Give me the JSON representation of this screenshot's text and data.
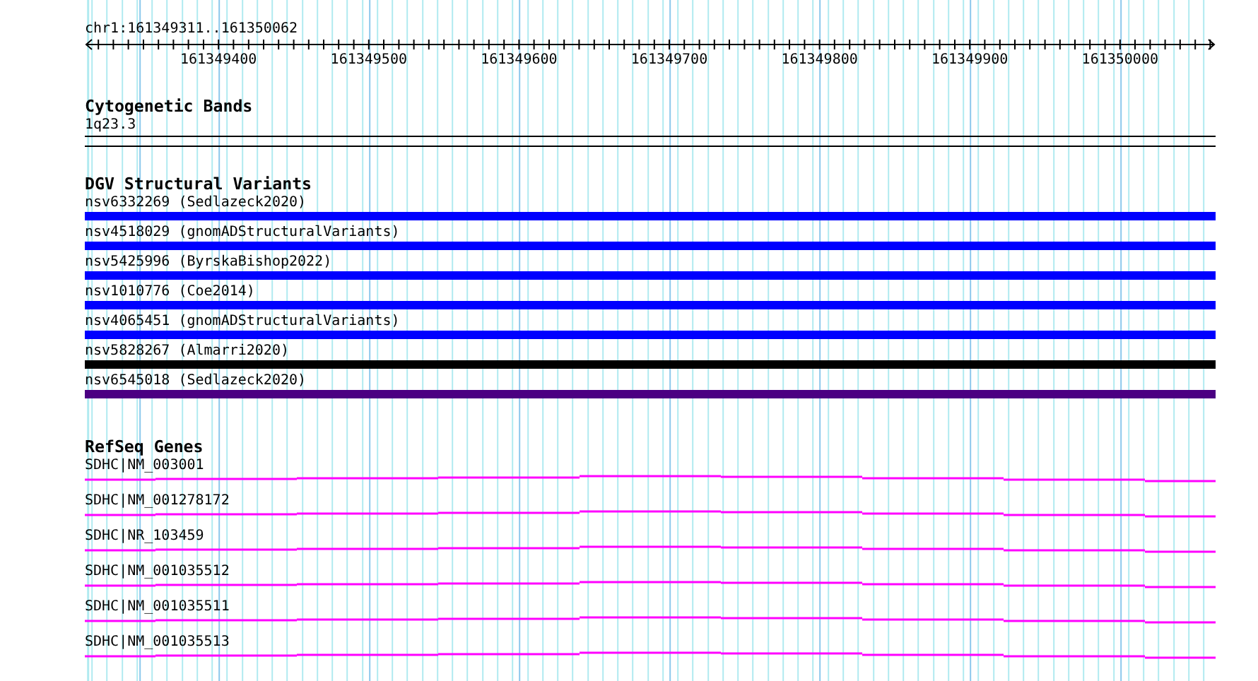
{
  "ruler": {
    "location": "chr1:161349311..161350062",
    "ticks": [
      "161349400",
      "161349500",
      "161349600",
      "161349700",
      "161349800",
      "161349900",
      "161350000"
    ]
  },
  "tracks": [
    {
      "kind": "bands",
      "title": "Cytogenetic Bands",
      "features": [
        {
          "label": "1q23.3"
        }
      ]
    },
    {
      "kind": "variants",
      "title": "DGV Structural Variants",
      "features": [
        {
          "label": "nsv6332269 (Sedlazeck2020)",
          "color": "#0000ff"
        },
        {
          "label": "nsv4518029 (gnomADStructuralVariants)",
          "color": "#0000ff"
        },
        {
          "label": "nsv5425996 (ByrskaBishop2022)",
          "color": "#0000ff"
        },
        {
          "label": "nsv1010776 (Coe2014)",
          "color": "#0000ff"
        },
        {
          "label": "nsv4065451 (gnomADStructuralVariants)",
          "color": "#0000ff"
        },
        {
          "label": "nsv5828267 (Almarri2020)",
          "color": "#000000"
        },
        {
          "label": "nsv6545018 (Sedlazeck2020)",
          "color": "#4b0082"
        }
      ]
    },
    {
      "kind": "genes",
      "title": "RefSeq Genes",
      "features": [
        {
          "label": "SDHC|NM_003001"
        },
        {
          "label": "SDHC|NM_001278172"
        },
        {
          "label": "SDHC|NR_103459"
        },
        {
          "label": "SDHC|NM_001035512"
        },
        {
          "label": "SDHC|NM_001035511"
        },
        {
          "label": "SDHC|NM_001035513"
        }
      ]
    }
  ]
}
